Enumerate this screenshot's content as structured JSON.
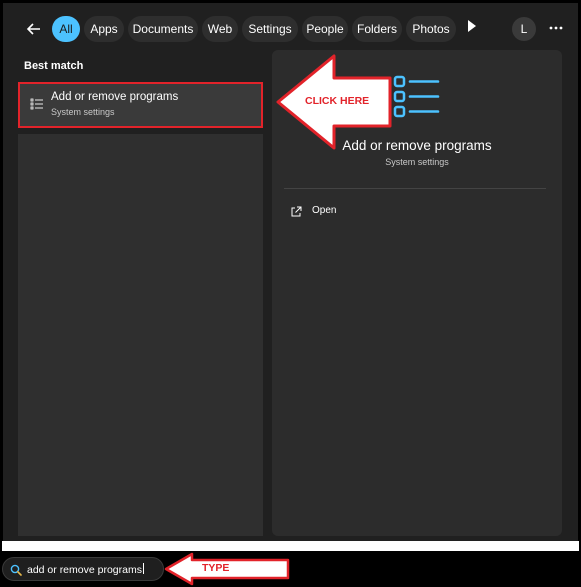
{
  "nav": {
    "back_icon": "arrow-left-icon",
    "filters": [
      {
        "label": "All",
        "active": true
      },
      {
        "label": "Apps",
        "active": false
      },
      {
        "label": "Documents",
        "active": false
      },
      {
        "label": "Web",
        "active": false
      },
      {
        "label": "Settings",
        "active": false
      },
      {
        "label": "People",
        "active": false
      },
      {
        "label": "Folders",
        "active": false
      },
      {
        "label": "Photos",
        "active": false
      }
    ],
    "more_filters_icon": "play-icon",
    "account_initial": "L",
    "options_icon": "ellipsis-icon"
  },
  "results": {
    "section_label": "Best match",
    "best_match": {
      "title": "Add or remove programs",
      "subtitle": "System settings",
      "icon": "list-settings-icon"
    }
  },
  "detail": {
    "title": "Add or remove programs",
    "subtitle": "System settings",
    "icon": "list-settings-icon",
    "actions": [
      {
        "label": "Open",
        "icon": "open-external-icon"
      }
    ]
  },
  "search": {
    "value": "add or remove programs",
    "icon": "search-icon"
  },
  "annotations": {
    "click_label": "CLICK HERE",
    "type_label": "TYPE"
  },
  "colors": {
    "accent": "#4cc2ff",
    "annotation_red": "#e2232a",
    "background": "#202020"
  }
}
